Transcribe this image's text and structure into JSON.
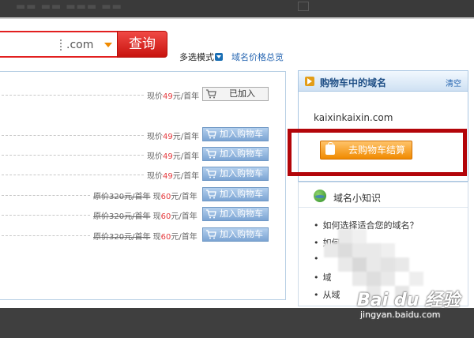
{
  "search": {
    "tld": ".com",
    "button_label": "查询"
  },
  "toolbar": {
    "multi_mode_label": "多选模式",
    "price_link": "域名价格总览"
  },
  "results": [
    {
      "price_label": "现价",
      "price": "49",
      "unit": "元/首年",
      "button": "已加入",
      "added": true
    },
    {
      "price_label": "现价",
      "price": "49",
      "unit": "元/首年",
      "button": "加入购物车",
      "added": false
    },
    {
      "price_label": "现价",
      "price": "49",
      "unit": "元/首年",
      "button": "加入购物车",
      "added": false
    },
    {
      "price_label": "现价",
      "price": "49",
      "unit": "元/首年",
      "button": "加入购物车",
      "added": false
    },
    {
      "orig_label": "原价",
      "orig_price": "320",
      "orig_unit": "元/首年",
      "price_label": "现",
      "price": "60",
      "unit": "元/首年",
      "button": "加入购物车",
      "added": false
    },
    {
      "orig_label": "原价",
      "orig_price": "320",
      "orig_unit": "元/首年",
      "price_label": "现",
      "price": "60",
      "unit": "元/首年",
      "button": "加入购物车",
      "added": false
    },
    {
      "orig_label": "原价",
      "orig_price": "320",
      "orig_unit": "元/首年",
      "price_label": "现",
      "price": "60",
      "unit": "元/首年",
      "button": "加入购物车",
      "added": false
    }
  ],
  "cart": {
    "title": "购物车中的域名",
    "clear": "清空",
    "domain": "kaixinkaixin.com",
    "checkout": "去购物车结算"
  },
  "knowledge": {
    "title": "域名小知识",
    "items": [
      "如何选择适合您的域名？",
      "如何购买",
      "",
      "域",
      "从域"
    ]
  },
  "watermark": {
    "main": "Bai du 经验",
    "sub": "jingyan.baidu.com"
  },
  "colors": {
    "accent_red": "#e21f1f",
    "highlight_border": "#b3050a",
    "link_blue": "#2565b1",
    "checkout_orange": "#f08a00"
  }
}
